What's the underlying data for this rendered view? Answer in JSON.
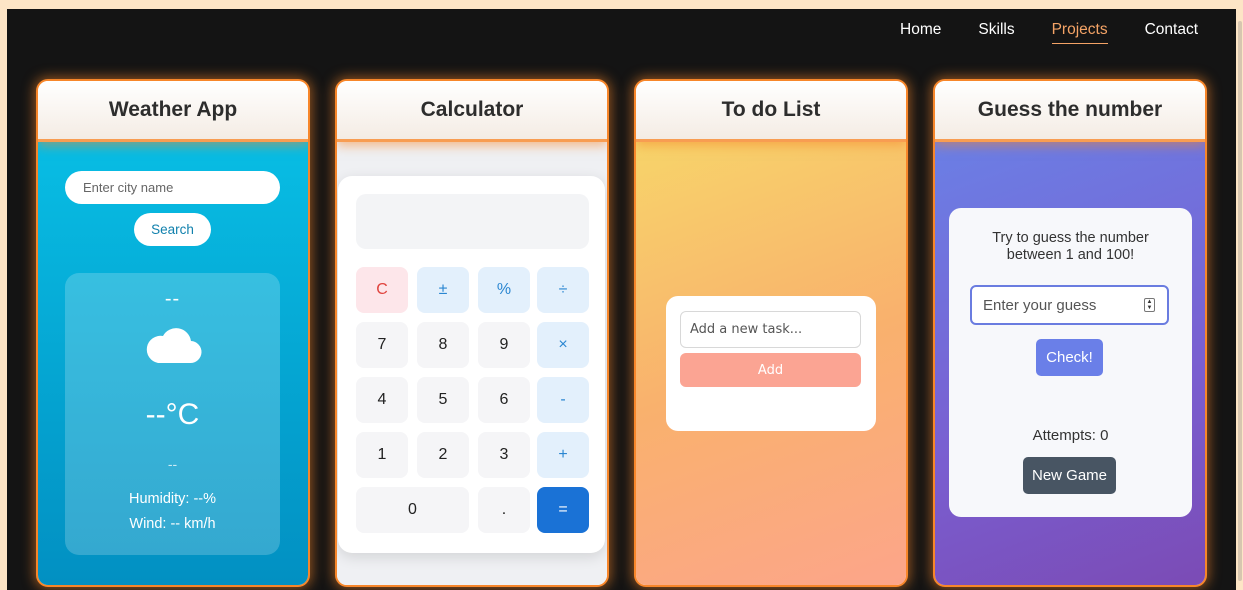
{
  "nav": {
    "items": [
      {
        "label": "Home",
        "active": false
      },
      {
        "label": "Skills",
        "active": false
      },
      {
        "label": "Projects",
        "active": true
      },
      {
        "label": "Contact",
        "active": false
      }
    ],
    "accent_color": "#f4a366"
  },
  "cards": {
    "weather": {
      "title": "Weather App",
      "input_placeholder": "Enter city name",
      "input_value": "",
      "search_label": "Search",
      "city": "--",
      "icon": "cloud-icon",
      "temperature": "--°C",
      "description": "--",
      "humidity": "Humidity: --%",
      "wind": "Wind: -- km/h"
    },
    "calculator": {
      "title": "Calculator",
      "display": "",
      "buttons": {
        "clear": "C",
        "sign": "±",
        "percent": "%",
        "divide": "÷",
        "seven": "7",
        "eight": "8",
        "nine": "9",
        "multiply": "×",
        "four": "4",
        "five": "5",
        "six": "6",
        "minus": "-",
        "one": "1",
        "two": "2",
        "three": "3",
        "plus": "+",
        "zero": "0",
        "dot": ".",
        "equals": "="
      }
    },
    "todo": {
      "title": "To do List",
      "input_placeholder": "Add a new task...",
      "input_value": "",
      "add_label": "Add"
    },
    "guess": {
      "title": "Guess the number",
      "prompt": "Try to guess the number between 1 and 100!",
      "input_placeholder": "Enter your guess",
      "check_label": "Check!",
      "attempts": "Attempts: 0",
      "new_game_label": "New Game"
    }
  },
  "colors": {
    "card_border": "#f7862a",
    "weather_bg": "#08bde4",
    "calc_equals": "#1a72d6",
    "todo_add": "#fba493",
    "guess_check": "#6a7fe8",
    "guess_new_game": "#485563"
  }
}
